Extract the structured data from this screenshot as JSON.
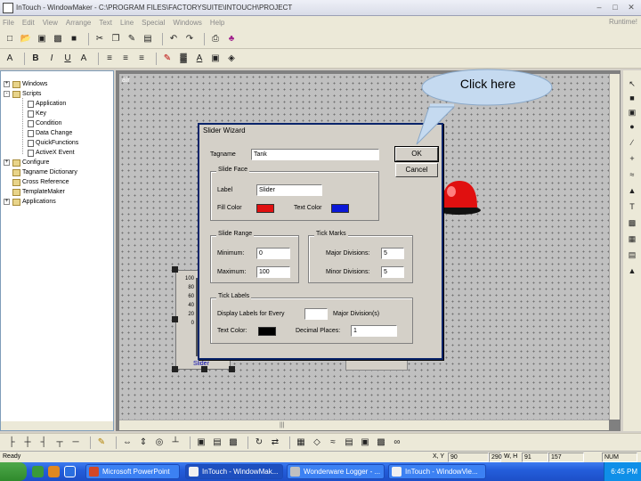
{
  "window": {
    "title": "InTouch - WindowMaker - C:\\PROGRAM FILES\\FACTORYSUITE\\INTOUCH\\PROJECT",
    "runtime_label": "Runtime!"
  },
  "menu": [
    "File",
    "Edit",
    "View",
    "Arrange",
    "Text",
    "Line",
    "Special",
    "Windows",
    "Help"
  ],
  "tree": {
    "top": [
      {
        "label": "Windows"
      },
      {
        "label": "Scripts"
      }
    ],
    "scripts_children": [
      "Application",
      "Key",
      "Condition",
      "Data Change",
      "QuickFunctions",
      "ActiveX Event"
    ],
    "bottom": [
      {
        "label": "Configure"
      },
      {
        "label": "Tagname Dictionary"
      },
      {
        "label": "Cross Reference"
      },
      {
        "label": "TemplateMaker"
      },
      {
        "label": "Applications"
      }
    ]
  },
  "canvas": {
    "window_name": "air",
    "slider_ticks": [
      "100",
      "80",
      "60",
      "40",
      "20",
      "0"
    ],
    "slider_label": "Slider"
  },
  "dialog": {
    "title": "Slider Wizard",
    "tagname_label": "Tagname",
    "tagname_value": "Tank",
    "ok": "OK",
    "cancel": "Cancel",
    "slide_face": {
      "title": "Slide Face",
      "label_label": "Label",
      "label_value": "Slider",
      "fill_color_label": "Fill Color",
      "fill_color": "#e01010",
      "text_color_label": "Text Color",
      "text_color": "#0a18d8"
    },
    "slide_range": {
      "title": "Slide Range",
      "minimum_label": "Minimum:",
      "minimum_value": "0",
      "maximum_label": "Maximum:",
      "maximum_value": "100"
    },
    "tick_marks": {
      "title": "Tick Marks",
      "major_label": "Major Divisions:",
      "major_value": "5",
      "minor_label": "Minor Divisions:",
      "minor_value": "5"
    },
    "tick_labels": {
      "title": "Tick Labels",
      "display_label": "Display Labels for Every",
      "display_value": "",
      "major_suffix": "Major Division(s)",
      "text_color_label": "Text Color:",
      "text_color": "#000000",
      "decimal_label": "Decimal Places:",
      "decimal_value": "1"
    }
  },
  "callout": {
    "text": "Click here"
  },
  "status": {
    "ready": "Ready",
    "xy_label": "X, Y",
    "x": "90",
    "y": "290",
    "w_label": "W, H",
    "w": "91",
    "h": "157",
    "num": "NUM"
  },
  "taskbar": {
    "tasks": [
      {
        "label": "Microsoft PowerPoint",
        "color": "#d24726"
      },
      {
        "label": "InTouch - WindowMak...",
        "color": "#f0f0f0"
      },
      {
        "label": "Wonderware Logger - ...",
        "color": "#c0c0c0"
      },
      {
        "label": "InTouch - WindowVie...",
        "color": "#f0f0f0"
      }
    ],
    "clock": "6:45 PM"
  }
}
